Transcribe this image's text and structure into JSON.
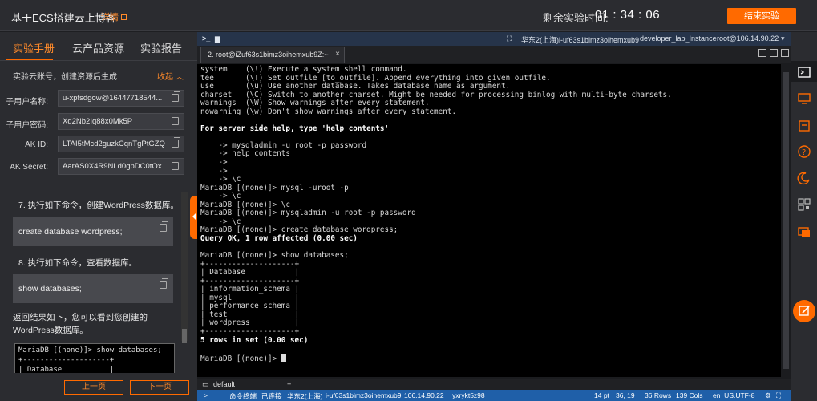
{
  "topbar": {
    "title": "基于ECS搭建云上博客",
    "detail_label": "详情",
    "timer_label": "剩余实验时间:",
    "timer_value": "01 : 34 : 06",
    "end_button": "结束实验"
  },
  "left_tabs": [
    {
      "label": "实验手册",
      "active": true
    },
    {
      "label": "云产品资源",
      "active": false
    },
    {
      "label": "实验报告",
      "active": false
    }
  ],
  "account": {
    "header": "实验云账号，创建资源后生成",
    "collapse_label": "收起",
    "fields": [
      {
        "label": "子用户名称:",
        "value": "u-xpfsdgow@16447718544..."
      },
      {
        "label": "子用户密码:",
        "value": "Xq2Nb2Iq88x0Mk5P"
      },
      {
        "label": "AK ID:",
        "value": "LTAI5tMcd2guzkCqnTgPtGZQ"
      },
      {
        "label": "AK Secret:",
        "value": "AarAS0X4R9NLd0gpDC0tOx..."
      }
    ]
  },
  "guide": {
    "step7": "7. 执行如下命令，创建WordPress数据库。",
    "code7": "create database wordpress;",
    "step8": "8. 执行如下命令，查看数据库。",
    "code8": "show databases;",
    "result": "返回结果如下，您可以看到您创建的WordPress数据库。",
    "mini_terminal": "MariaDB [(none)]> show databases;\n+--------------------+\n| Database           |"
  },
  "pager": {
    "prev": "上一页",
    "next": "下一页"
  },
  "terminal_header": {
    "region": "华东2(上海)i-uf63s1bimz3oihemxub9",
    "instance": "developer_lab_Instance",
    "host": "root@106.14.90.22"
  },
  "terminal_tab": "2. root@iZuf63s1bimz3oihemxub9Z:~",
  "terminal_lines": [
    {
      "t": "system    (\\!) Execute a system shell command.",
      "b": false
    },
    {
      "t": "tee       (\\T) Set outfile [to_outfile]. Append everything into given outfile.",
      "b": false
    },
    {
      "t": "use       (\\u) Use another database. Takes database name as argument.",
      "b": false
    },
    {
      "t": "charset   (\\C) Switch to another charset. Might be needed for processing binlog with multi-byte charsets.",
      "b": false
    },
    {
      "t": "warnings  (\\W) Show warnings after every statement.",
      "b": false
    },
    {
      "t": "nowarning (\\w) Don't show warnings after every statement.",
      "b": false
    },
    {
      "t": "",
      "b": false
    },
    {
      "t": "For server side help, type 'help contents'",
      "b": true
    },
    {
      "t": "",
      "b": false
    },
    {
      "t": "    -> mysqladmin -u root -p password",
      "b": false
    },
    {
      "t": "    -> help contents",
      "b": false
    },
    {
      "t": "    ->",
      "b": false
    },
    {
      "t": "    ->",
      "b": false
    },
    {
      "t": "    -> \\c",
      "b": false
    },
    {
      "t": "MariaDB [(none)]> mysql -uroot -p",
      "b": false
    },
    {
      "t": "    -> \\c",
      "b": false
    },
    {
      "t": "MariaDB [(none)]> \\c",
      "b": false
    },
    {
      "t": "MariaDB [(none)]> mysqladmin -u root -p password",
      "b": false
    },
    {
      "t": "    -> \\c",
      "b": false
    },
    {
      "t": "MariaDB [(none)]> create database wordpress;",
      "b": false
    },
    {
      "t": "Query OK, 1 row affected (0.00 sec)",
      "b": true
    },
    {
      "t": "",
      "b": false
    },
    {
      "t": "MariaDB [(none)]> show databases;",
      "b": false
    },
    {
      "t": "+--------------------+",
      "b": false
    },
    {
      "t": "| Database           |",
      "b": false
    },
    {
      "t": "+--------------------+",
      "b": false
    },
    {
      "t": "| information_schema |",
      "b": false
    },
    {
      "t": "| mysql              |",
      "b": false
    },
    {
      "t": "| performance_schema |",
      "b": false
    },
    {
      "t": "| test               |",
      "b": false
    },
    {
      "t": "| wordpress          |",
      "b": false
    },
    {
      "t": "+--------------------+",
      "b": false
    },
    {
      "t": "5 rows in set (0.00 sec)",
      "b": true
    },
    {
      "t": "",
      "b": false
    },
    {
      "t": "MariaDB [(none)]> ",
      "b": false,
      "cursor": true
    }
  ],
  "session_bar": {
    "session": "default",
    "add": "+"
  },
  "status_bar": {
    "cmd_input": "命令终端",
    "connected": "已连接",
    "region": "华东2(上海)",
    "instance": "i-uf63s1bimz3oihemxub9",
    "ip": "106.14.90.22",
    "user": "yxrykt5z98",
    "font": "14 pt",
    "pos": "36, 19",
    "rows": "36 Rows",
    "cols": "139 Cols",
    "encoding": "en_US.UTF-8"
  },
  "colors": {
    "accent": "#ff6a00",
    "status_blue": "#1f5fa8"
  }
}
